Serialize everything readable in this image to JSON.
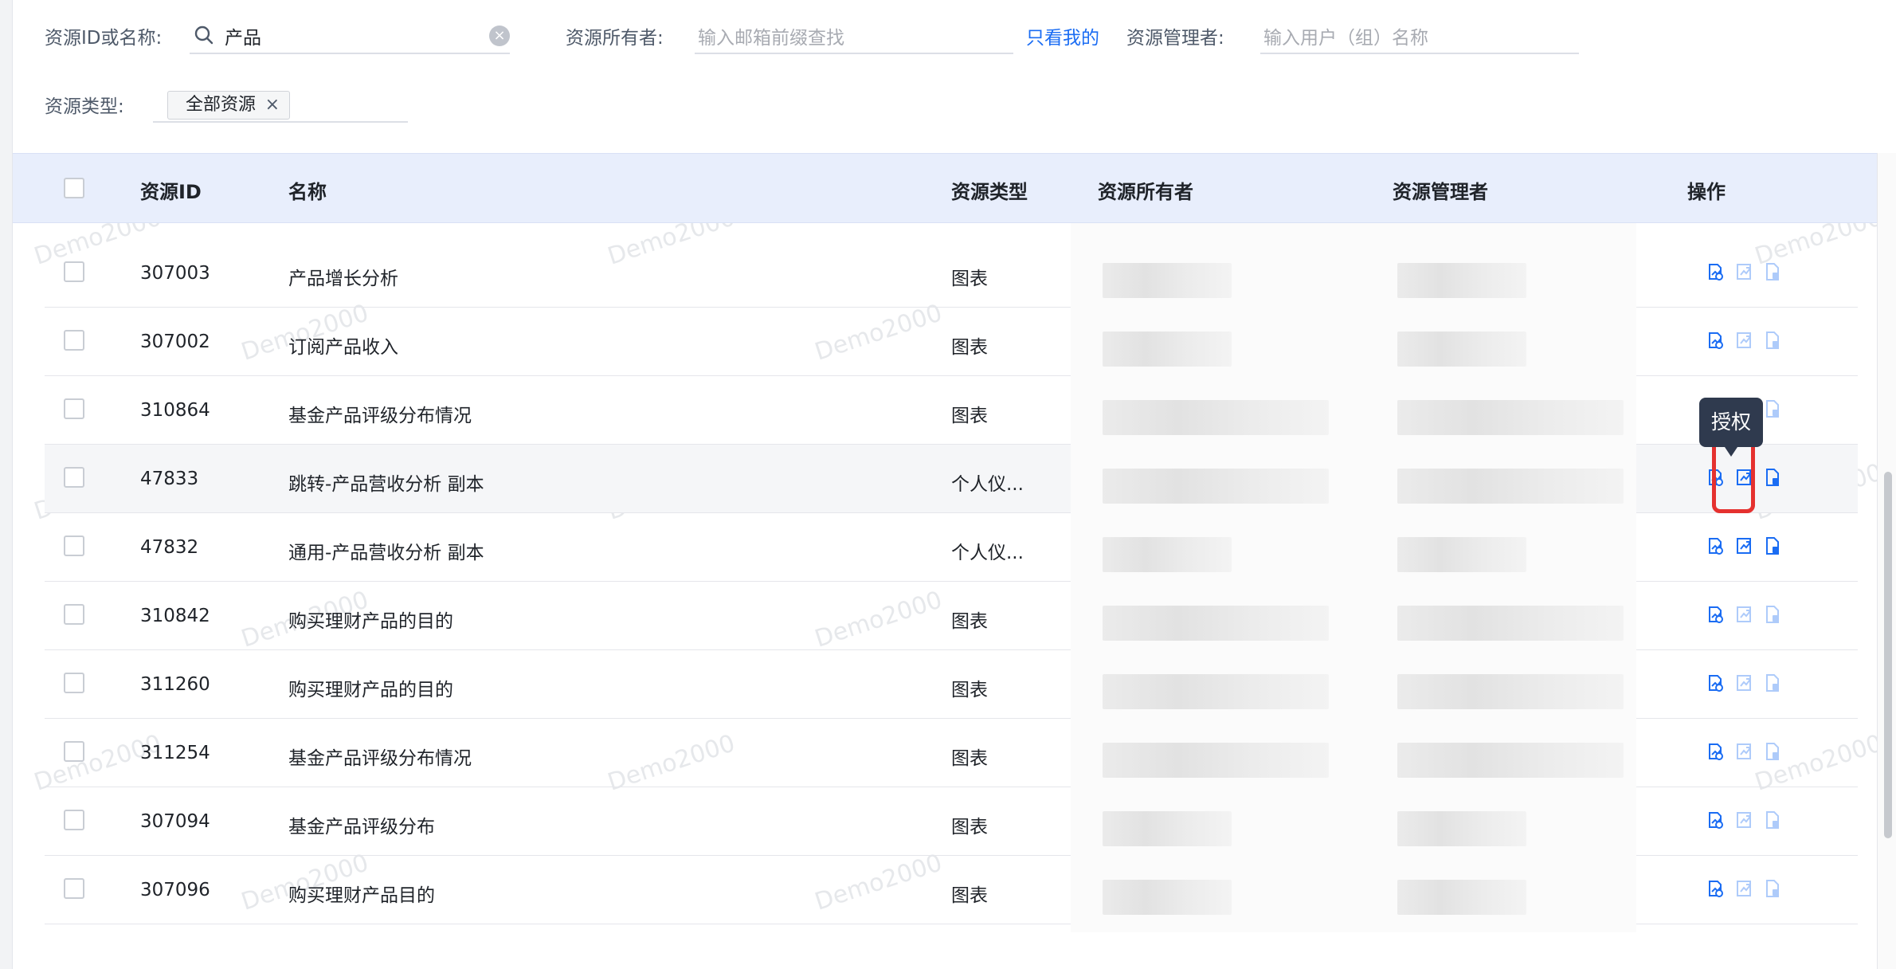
{
  "filters": {
    "resource_label": "资源ID或名称:",
    "resource_value": "产品",
    "owner_label": "资源所有者:",
    "owner_placeholder": "输入邮箱前缀查找",
    "only_mine_link": "只看我的",
    "manager_label": "资源管理者:",
    "manager_placeholder": "输入用户（组）名称",
    "type_label": "资源类型:",
    "type_tag": "全部资源",
    "tag_close": "×"
  },
  "table": {
    "headers": [
      "资源ID",
      "名称",
      "资源类型",
      "资源所有者",
      "资源管理者",
      "操作"
    ],
    "rows": [
      {
        "id": "307003",
        "name": "产品增长分析",
        "type": "图表"
      },
      {
        "id": "307002",
        "name": "订阅产品收入",
        "type": "图表"
      },
      {
        "id": "310864",
        "name": "基金产品评级分布情况",
        "type": "图表"
      },
      {
        "id": "47833",
        "name": "跳转-产品营收分析 副本",
        "type": "个人仪..."
      },
      {
        "id": "47832",
        "name": "通用-产品营收分析 副本",
        "type": "个人仪..."
      },
      {
        "id": "310842",
        "name": "购买理财产品的目的",
        "type": "图表"
      },
      {
        "id": "311260",
        "name": "购买理财产品的目的",
        "type": "图表"
      },
      {
        "id": "311254",
        "name": "基金产品评级分布情况",
        "type": "图表"
      },
      {
        "id": "307094",
        "name": "基金产品评级分布",
        "type": "图表"
      },
      {
        "id": "307096",
        "name": "购买理财产品目的",
        "type": "图表"
      }
    ]
  },
  "tooltip": "授权",
  "watermark": "Demo2000",
  "colors": {
    "accent": "#1a6cf3",
    "header_bg": "#e8eefc",
    "highlight": "#e5312f"
  }
}
